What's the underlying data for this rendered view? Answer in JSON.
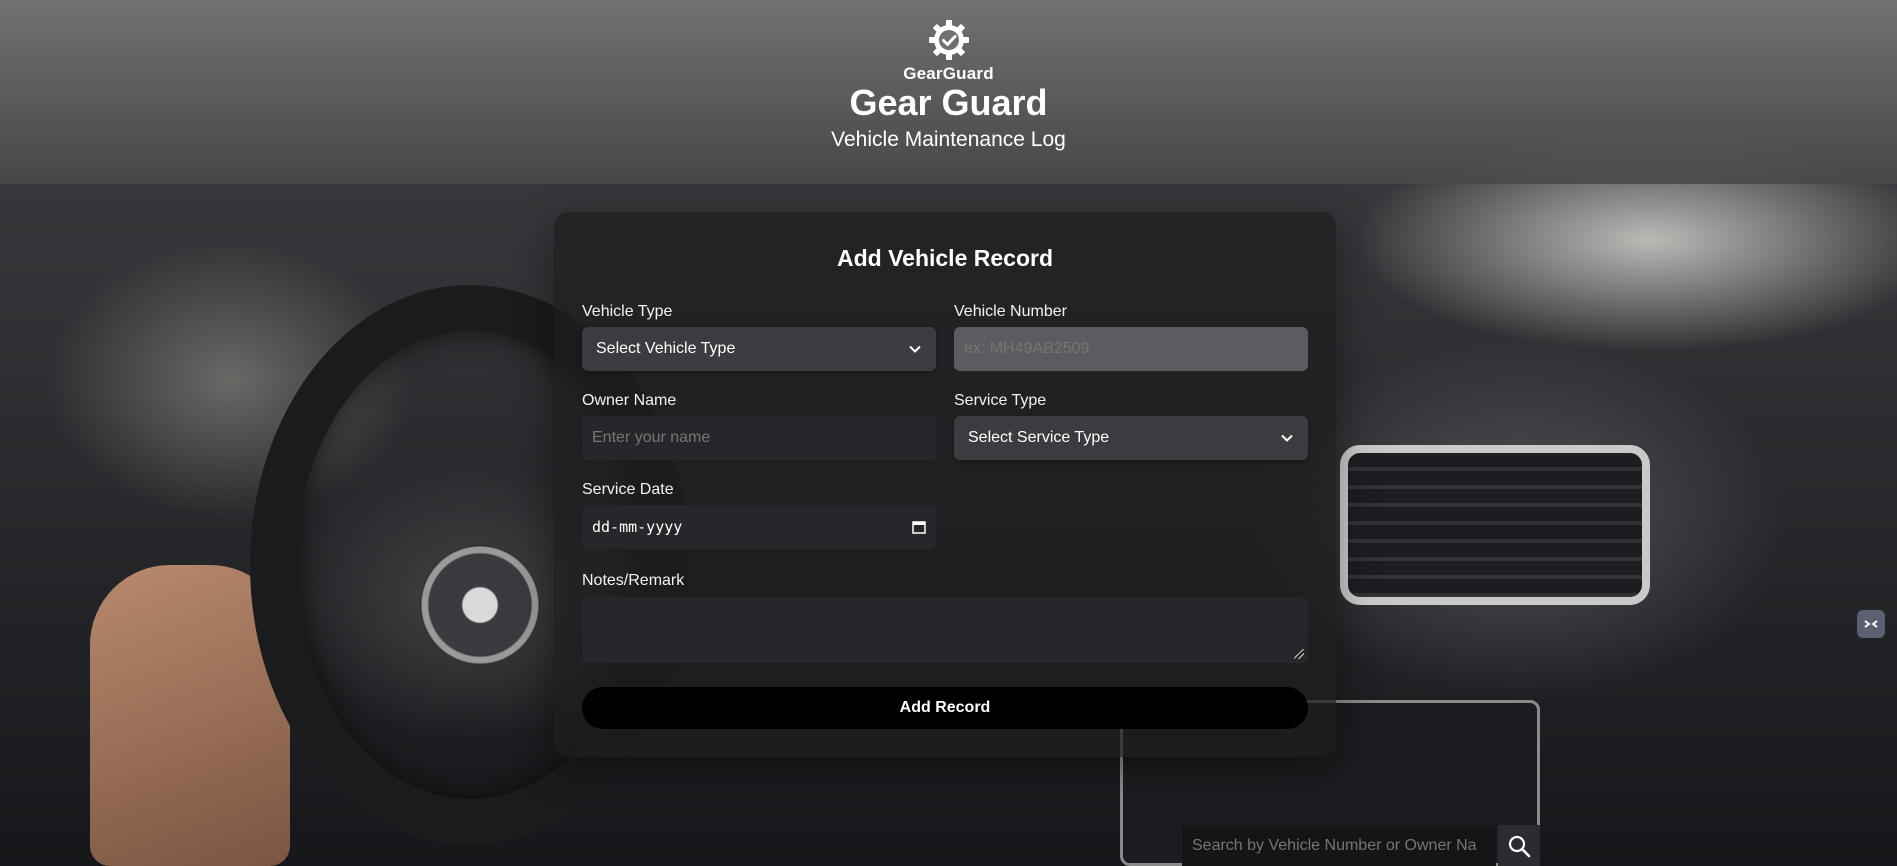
{
  "header": {
    "logo_icon": "gear-check-icon",
    "logo_text": "GearGuard",
    "title": "Gear Guard",
    "subtitle": "Vehicle Maintenance Log"
  },
  "form": {
    "title": "Add Vehicle Record",
    "vehicle_type": {
      "label": "Vehicle Type",
      "value": "Select Vehicle Type"
    },
    "vehicle_number": {
      "label": "Vehicle Number",
      "placeholder": "ex: MH49AB2509"
    },
    "owner_name": {
      "label": "Owner Name",
      "placeholder": "Enter your name"
    },
    "service_type": {
      "label": "Service Type",
      "value": "Select Service Type"
    },
    "service_date": {
      "label": "Service Date",
      "value": "dd-mm-yyyy"
    },
    "notes": {
      "label": "Notes/Remark",
      "value": ""
    },
    "submit_label": "Add Record"
  },
  "search": {
    "placeholder": "Search by Vehicle Number or Owner Na",
    "icon": "search-icon"
  },
  "colors": {
    "card_bg": "#1c1d1f",
    "button_bg": "#000000",
    "header_bg": "#7a7c7e"
  }
}
